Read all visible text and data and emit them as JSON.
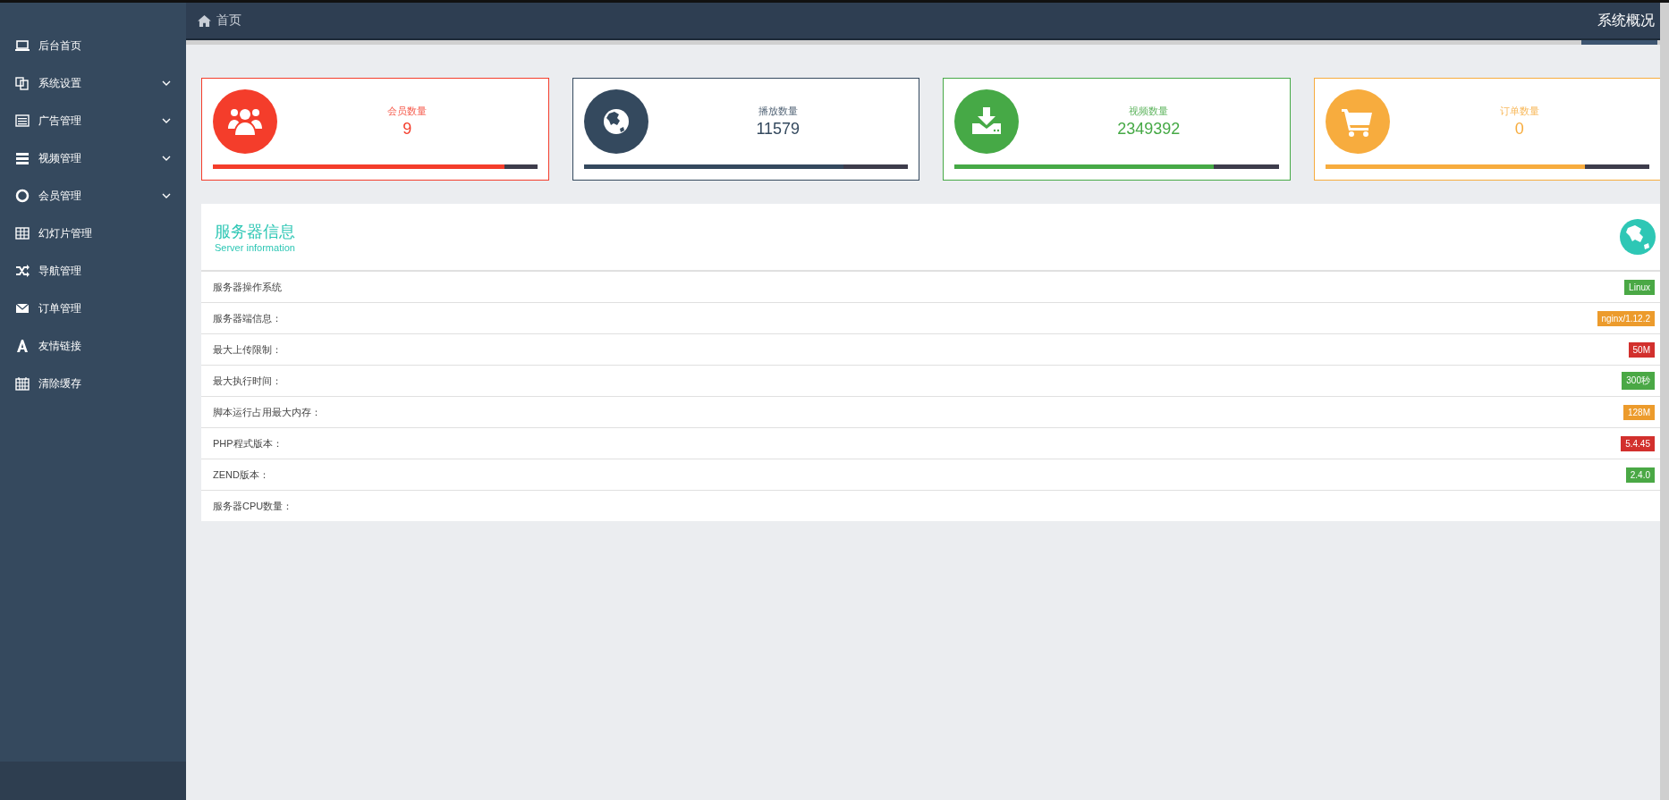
{
  "sidebar": {
    "items": [
      {
        "label": "后台首页",
        "expandable": false
      },
      {
        "label": "系统设置",
        "expandable": true
      },
      {
        "label": "广告管理",
        "expandable": true
      },
      {
        "label": "视频管理",
        "expandable": true
      },
      {
        "label": "会员管理",
        "expandable": true
      },
      {
        "label": "幻灯片管理",
        "expandable": false
      },
      {
        "label": "导航管理",
        "expandable": false
      },
      {
        "label": "订单管理",
        "expandable": false
      },
      {
        "label": "友情链接",
        "expandable": false
      },
      {
        "label": "清除缓存",
        "expandable": false
      }
    ]
  },
  "topbar": {
    "breadcrumb": "首页",
    "page_title": "系统概况"
  },
  "stats": [
    {
      "label": "会员数量",
      "value": "9",
      "color": "#f43d2b",
      "level": 0.9
    },
    {
      "label": "播放数量",
      "value": "11579",
      "color": "#34495e",
      "level": 0.8
    },
    {
      "label": "视频数量",
      "value": "2349392",
      "color": "#46a946",
      "level": 0.8
    },
    {
      "label": "订单数量",
      "value": "0",
      "color": "#f7ac3e",
      "level": 0.8
    }
  ],
  "server": {
    "title": "服务器信息",
    "subtitle": "Server information",
    "rows": [
      {
        "label": "服务器操作系统",
        "value": "Linux",
        "color": "#4aa845"
      },
      {
        "label": "服务器端信息：",
        "value": "nginx/1.12.2",
        "color": "#ec9b2c"
      },
      {
        "label": "最大上传限制：",
        "value": "50M",
        "color": "#d2302d"
      },
      {
        "label": "最大执行时间：",
        "value": "300秒",
        "color": "#4aa845"
      },
      {
        "label": "脚本运行占用最大内存：",
        "value": "128M",
        "color": "#ec9b2c"
      },
      {
        "label": "PHP程式版本：",
        "value": "5.4.45",
        "color": "#d2302d"
      },
      {
        "label": "ZEND版本：",
        "value": "2.4.0",
        "color": "#4aa845"
      },
      {
        "label": "服务器CPU数量："
      }
    ]
  }
}
